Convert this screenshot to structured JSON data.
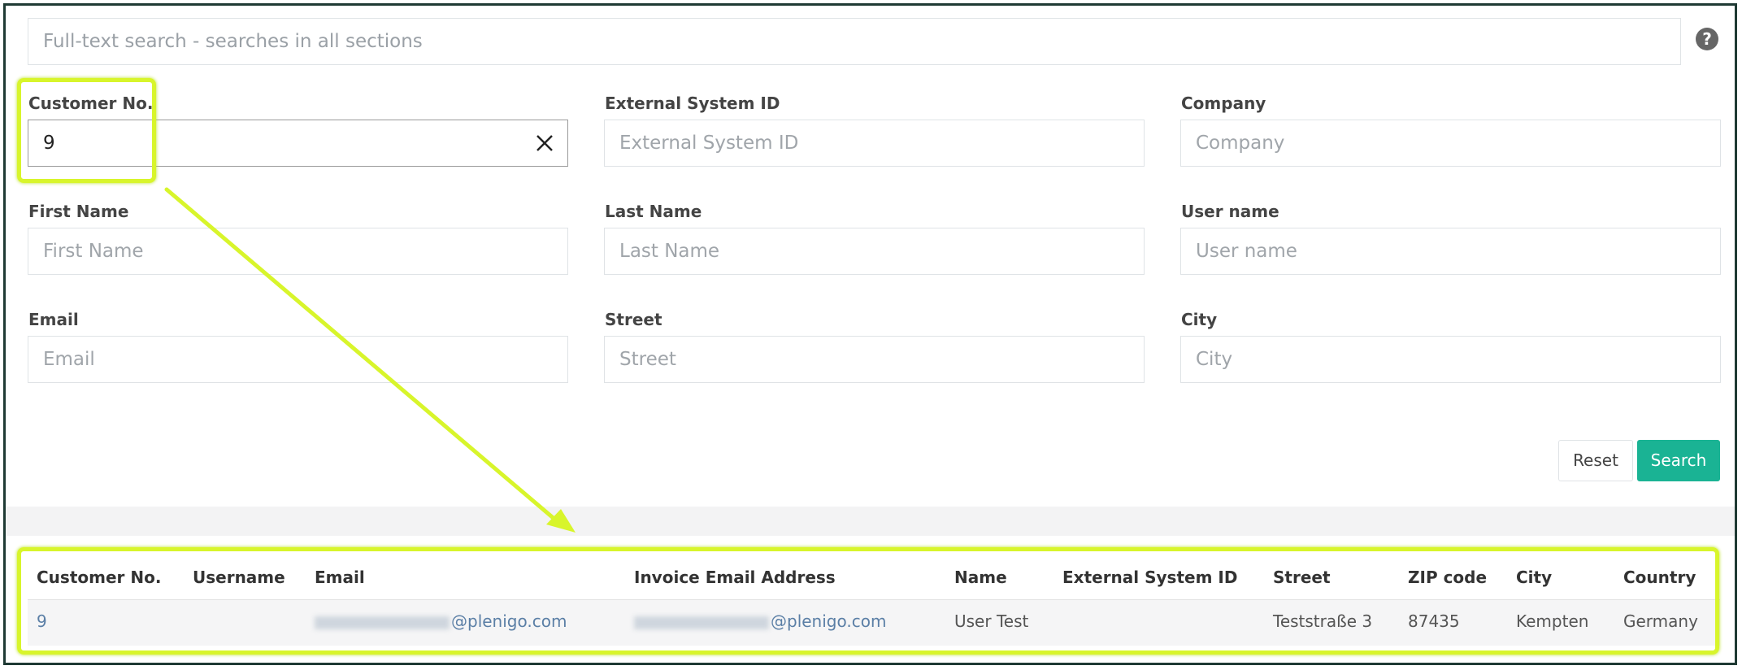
{
  "search": {
    "placeholder": "Full-text search - searches in all sections"
  },
  "help_icon": "?",
  "fields": {
    "customer_no": {
      "label": "Customer No.",
      "value": "9"
    },
    "external_system_id": {
      "label": "External System ID",
      "placeholder": "External System ID"
    },
    "company": {
      "label": "Company",
      "placeholder": "Company"
    },
    "first_name": {
      "label": "First Name",
      "placeholder": "First Name"
    },
    "last_name": {
      "label": "Last Name",
      "placeholder": "Last Name"
    },
    "user_name": {
      "label": "User name",
      "placeholder": "User name"
    },
    "email": {
      "label": "Email",
      "placeholder": "Email"
    },
    "street": {
      "label": "Street",
      "placeholder": "Street"
    },
    "city": {
      "label": "City",
      "placeholder": "City"
    }
  },
  "buttons": {
    "reset": "Reset",
    "search": "Search"
  },
  "table": {
    "headers": [
      "Customer No.",
      "Username",
      "Email",
      "Invoice Email Address",
      "Name",
      "External System ID",
      "Street",
      "ZIP code",
      "City",
      "Country"
    ],
    "row": {
      "customer_no": "9",
      "username": "",
      "email_suffix": "@plenigo.com",
      "invoice_email_suffix": "@plenigo.com",
      "name": "User Test",
      "external_system_id": "",
      "street": "Teststraße 3",
      "zip": "87435",
      "city": "Kempten",
      "country": "Germany"
    }
  },
  "colors": {
    "accent": "#1ab394",
    "highlight": "#d8f52b",
    "frame": "#1f3a34",
    "link": "#5b7fa6"
  }
}
